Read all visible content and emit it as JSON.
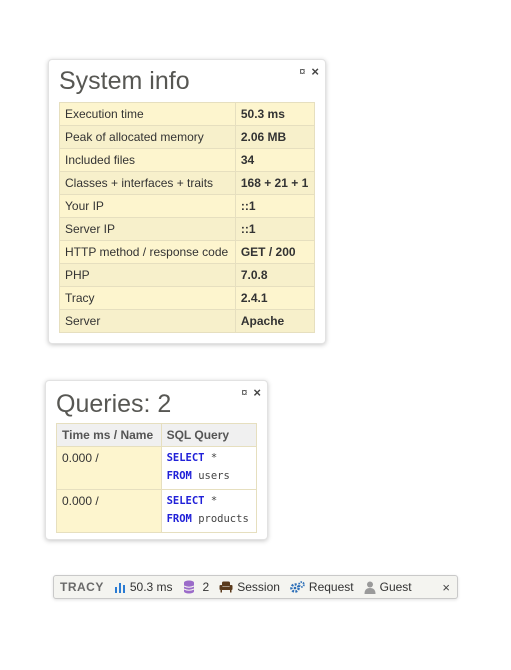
{
  "panel_icons": {
    "pin": "¤",
    "close": "×"
  },
  "system_info": {
    "title": "System info",
    "rows": [
      {
        "label": "Execution time",
        "value": "50.3 ms"
      },
      {
        "label": "Peak of allocated memory",
        "value": "2.06 MB"
      },
      {
        "label": "Included files",
        "value": "34"
      },
      {
        "label": "Classes + interfaces + traits",
        "value": "168 + 21 + 1"
      },
      {
        "label": "Your IP",
        "value": "::1"
      },
      {
        "label": "Server IP",
        "value": "::1"
      },
      {
        "label": "HTTP method / response code",
        "value": "GET / 200"
      },
      {
        "label": "PHP",
        "value": "7.0.8"
      },
      {
        "label": "Tracy",
        "value": "2.4.1"
      },
      {
        "label": "Server",
        "value": "Apache"
      }
    ]
  },
  "queries": {
    "title": "Queries: 2",
    "headers": {
      "time": "Time ms / Name",
      "sql": "SQL Query"
    },
    "rows": [
      {
        "time": "0.000 /",
        "kw1": "SELECT",
        "rest1": " *",
        "kw2": "FROM",
        "rest2": " users"
      },
      {
        "time": "0.000 /",
        "kw1": "SELECT",
        "rest1": " *",
        "kw2": "FROM",
        "rest2": " products"
      }
    ]
  },
  "tracy_bar": {
    "logo": "TRACY",
    "time": "50.3 ms",
    "queries_count": "2",
    "session": "Session",
    "request": "Request",
    "user": "Guest",
    "close": "×"
  },
  "colors": {
    "row_odd": "#fdf5ce",
    "row_even": "#f7f0cb",
    "sql_keyword": "#2020d8",
    "chart_icon": "#2a7bd3",
    "db_icon": "#9b6bc9",
    "session_icon": "#5a3a1c",
    "request_icon": "#2d6fb8",
    "user_icon": "#9a9a9a"
  },
  "icons": [
    "pin-icon",
    "close-icon",
    "chart-icon",
    "database-icon",
    "armchair-icon",
    "gears-icon",
    "user-icon"
  ]
}
